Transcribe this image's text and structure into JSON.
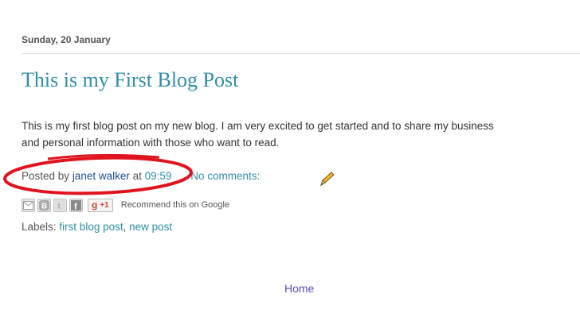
{
  "date_header": "Sunday, 20 January",
  "post": {
    "title": "This is my First Blog Post",
    "body_line1": "This is my first blog post on my new blog. I am very excited to get started and to share my business",
    "body_line2": "and personal information with those who want to read.",
    "posted_by_label": "Posted by",
    "author": "janet walker",
    "at_label": "at",
    "time": "09:59",
    "comments": "No comments:"
  },
  "share": {
    "email_icon": "email-icon",
    "blogthis_icon": "blogger-icon",
    "twitter_icon": "twitter-icon",
    "facebook_icon": "facebook-icon",
    "plusone_g": "g",
    "plusone_label": "+1",
    "recommend_text": "Recommend this on Google"
  },
  "labels": {
    "prefix": "Labels:",
    "items": [
      "first blog post",
      "new post"
    ],
    "separator": ","
  },
  "nav": {
    "home": "Home"
  },
  "annotation": {
    "color": "#e0141e"
  }
}
